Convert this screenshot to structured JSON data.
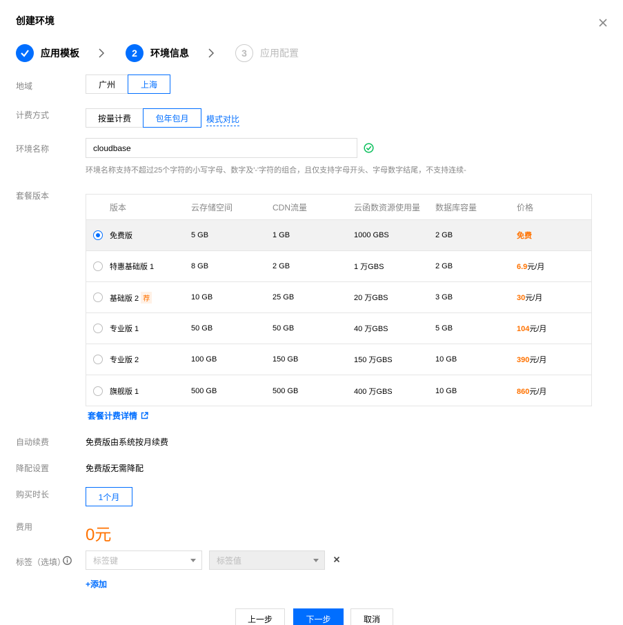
{
  "dialog": {
    "title": "创建环境"
  },
  "steps": [
    {
      "num": "",
      "label": "应用模板"
    },
    {
      "num": "2",
      "label": "环境信息"
    },
    {
      "num": "3",
      "label": "应用配置"
    }
  ],
  "region": {
    "label": "地域",
    "options": [
      "广州",
      "上海"
    ],
    "selected": "上海"
  },
  "billing": {
    "label": "计费方式",
    "options": [
      "按量计费",
      "包年包月"
    ],
    "selected": "包年包月",
    "compare_link": "模式对比"
  },
  "env_name": {
    "label": "环境名称",
    "value": "cloudbase",
    "hint": "环境名称支持不超过25个字符的小写字母、数字及'-'字符的组合，且仅支持字母开头、字母数字结尾，不支持连续-"
  },
  "plan": {
    "label": "套餐版本",
    "headers": [
      "版本",
      "云存储空间",
      "CDN流量",
      "云函数资源使用量",
      "数据库容量",
      "价格"
    ],
    "rows": [
      {
        "name": "免费版",
        "storage": "5 GB",
        "cdn": "1 GB",
        "func": "1000 GBS",
        "db": "2 GB",
        "price": "免费",
        "unit": "",
        "selected": true
      },
      {
        "name": "特惠基础版 1",
        "storage": "8 GB",
        "cdn": "2 GB",
        "func": "1 万GBS",
        "db": "2 GB",
        "price": "6.9",
        "unit": "元/月"
      },
      {
        "name": "基础版 2",
        "badge": "荐",
        "storage": "10 GB",
        "cdn": "25 GB",
        "func": "20 万GBS",
        "db": "3 GB",
        "price": "30",
        "unit": "元/月"
      },
      {
        "name": "专业版 1",
        "storage": "50 GB",
        "cdn": "50 GB",
        "func": "40 万GBS",
        "db": "5 GB",
        "price": "104",
        "unit": "元/月"
      },
      {
        "name": "专业版 2",
        "storage": "100 GB",
        "cdn": "150 GB",
        "func": "150 万GBS",
        "db": "10 GB",
        "price": "390",
        "unit": "元/月"
      },
      {
        "name": "旗舰版 1",
        "storage": "500 GB",
        "cdn": "500 GB",
        "func": "400 万GBS",
        "db": "10 GB",
        "price": "860",
        "unit": "元/月"
      }
    ],
    "detail_link": "套餐计费详情"
  },
  "auto_renew": {
    "label": "自动续费",
    "value": "免费版由系统按月续费"
  },
  "downgrade": {
    "label": "降配设置",
    "value": "免费版无需降配"
  },
  "duration": {
    "label": "购买时长",
    "value": "1个月"
  },
  "fee": {
    "label": "费用",
    "value": "0元"
  },
  "tags": {
    "label": "标签（选填）",
    "key_placeholder": "标签键",
    "value_placeholder": "标签值",
    "add": "添加"
  },
  "footer": {
    "prev": "上一步",
    "next": "下一步",
    "cancel": "取消"
  },
  "colors": {
    "accent": "#006eff",
    "price": "#ff7200",
    "success": "#0abf5b"
  }
}
